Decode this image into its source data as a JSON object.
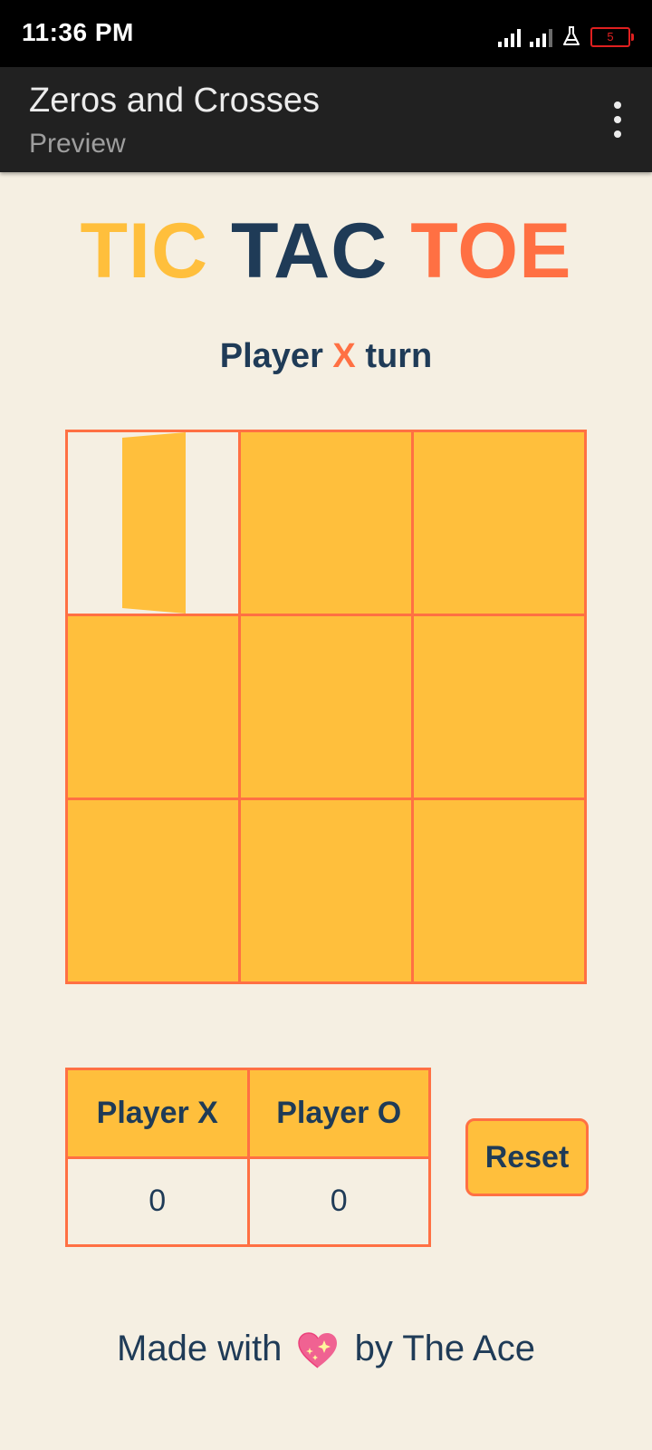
{
  "status_bar": {
    "time": "11:36 PM",
    "battery_level": "5"
  },
  "app_bar": {
    "title": "Zeros and Crosses",
    "subtitle": "Preview",
    "menu_icon": "more-vert-icon"
  },
  "game": {
    "title_part1": "TIC",
    "title_part2": "TAC",
    "title_part3": "TOE",
    "turn_prefix": "Player",
    "turn_player": "X",
    "turn_suffix": "turn",
    "board": [
      "",
      "",
      "",
      "",
      "",
      "",
      "",
      "",
      ""
    ]
  },
  "scores": {
    "player_x_label": "Player X",
    "player_o_label": "Player O",
    "player_x_score": "0",
    "player_o_score": "0"
  },
  "reset_label": "Reset",
  "footer": {
    "prefix": "Made with",
    "icon": "sparkling-heart-icon",
    "suffix": "by The Ace"
  },
  "colors": {
    "yellow": "#ffbf3c",
    "navy": "#1f3b57",
    "orange": "#ff7043",
    "background": "#f5efe2"
  }
}
